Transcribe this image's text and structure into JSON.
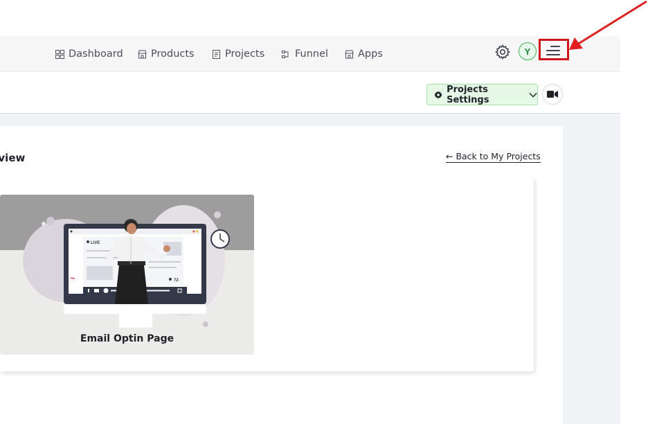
{
  "nav": {
    "links": [
      {
        "label": "Dashboard",
        "icon": "dashboard-grid-icon"
      },
      {
        "label": "Products",
        "icon": "store-icon"
      },
      {
        "label": "Projects",
        "icon": "document-icon"
      },
      {
        "label": "Funnel",
        "icon": "funnel-flow-icon"
      },
      {
        "label": "Apps",
        "icon": "store-icon"
      }
    ],
    "avatar_initial": "Y"
  },
  "subheader": {
    "settings_label": "Projects Settings"
  },
  "main": {
    "title": "rview",
    "back_link": "← Back to My Projects",
    "projects": [
      {
        "name": "Email Optin Page",
        "live_label": "LIVE",
        "viewer_count": "72"
      }
    ]
  },
  "colors": {
    "accent_green": "#3cb451",
    "highlight_red": "#d3131b",
    "settings_bg": "#e6f8e6"
  }
}
